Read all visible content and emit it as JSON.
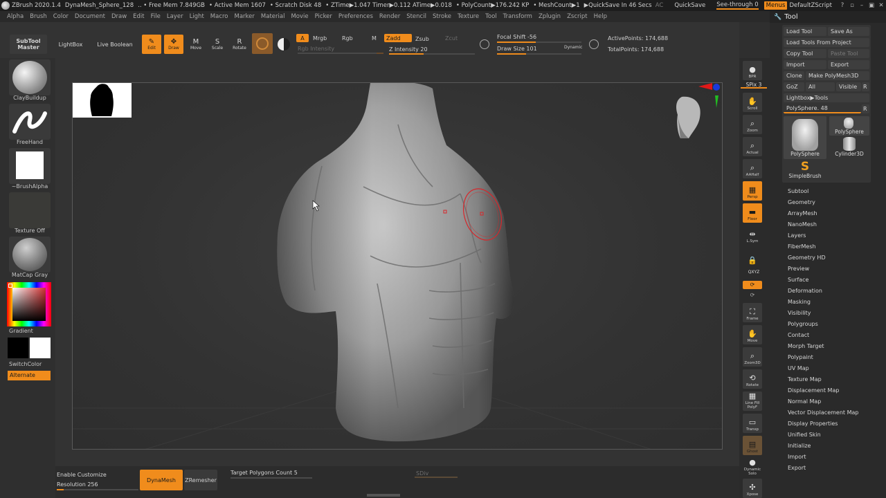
{
  "titlebar": {
    "app": "ZBrush 2020.1.4",
    "document": "DynaMesh_Sphere_128",
    "free_mem": ".. • Free Mem 7.849GB",
    "active_mem": "• Active Mem 1607",
    "scratch": "• Scratch Disk 48",
    "ztime": "• ZTime▶1.047 Timer▶0.112 ATime▶0.018",
    "polycount": "• PolyCount▶176.242 KP",
    "meshcount": "• MeshCount▶1",
    "quicksave": "▶QuickSave In 46 Secs",
    "ac": "AC",
    "quicksave_btn": "QuickSave",
    "see_through": "See-through  0",
    "menus": "Menus",
    "script": "DefaultZScript"
  },
  "menus": [
    "Alpha",
    "Brush",
    "Color",
    "Document",
    "Draw",
    "Edit",
    "File",
    "Layer",
    "Light",
    "Macro",
    "Marker",
    "Material",
    "Movie",
    "Picker",
    "Preferences",
    "Render",
    "Stencil",
    "Stroke",
    "Texture",
    "Tool",
    "Transform",
    "Zplugin",
    "Zscript",
    "Help"
  ],
  "toolbar": {
    "subtool_master": "SubTool Master",
    "lightbox": "LightBox",
    "live_boolean": "Live Boolean",
    "edit": "Edit",
    "draw": "Draw",
    "move": "Move",
    "scale": "Scale",
    "rotate": "Rotate",
    "a": "A",
    "mrgb": "Mrgb",
    "rgb": "Rgb",
    "m": "M",
    "zadd": "Zadd",
    "zsub": "Zsub",
    "zcut": "Zcut",
    "rgb_intensity": "Rgb Intensity",
    "z_intensity": "Z Intensity 20",
    "focal_shift": "Focal Shift -56",
    "draw_size": "Draw Size 101",
    "dynamic": "Dynamic",
    "active_points": "ActivePoints: 174,688",
    "total_points": "TotalPoints: 174,688"
  },
  "leftshelf": {
    "brush": "ClayBuildup",
    "stroke": "FreeHand",
    "alpha": "~BrushAlpha",
    "texture": "Texture Off",
    "material": "MatCap Gray",
    "gradient": "Gradient",
    "switchcolor": "SwitchColor",
    "alternate": "Alternate"
  },
  "rightshelf": [
    {
      "name": "bpr",
      "label": "BPR",
      "icon": "sphere-icon"
    },
    {
      "name": "spix",
      "label": "SPix 3",
      "icon": ""
    },
    {
      "name": "scroll",
      "label": "Scroll",
      "icon": "hand-icon"
    },
    {
      "name": "zoom",
      "label": "Zoom",
      "icon": "zoom-icon"
    },
    {
      "name": "actual",
      "label": "Actual",
      "icon": "zoom-icon"
    },
    {
      "name": "aahalf",
      "label": "AAHalf",
      "icon": "zoom-icon"
    },
    {
      "name": "persp",
      "label": "Persp",
      "icon": "grid-icon"
    },
    {
      "name": "floor",
      "label": "Floor",
      "icon": "floor-icon"
    },
    {
      "name": "lsym",
      "label": "L.Sym",
      "icon": "sym-icon"
    },
    {
      "name": "lock",
      "label": "",
      "icon": "lock-icon"
    },
    {
      "name": "xyz",
      "label": "QXYZ",
      "icon": ""
    },
    {
      "name": "frame",
      "label": "Frame",
      "icon": "frame-icon"
    },
    {
      "name": "move",
      "label": "Move",
      "icon": "hand-icon"
    },
    {
      "name": "zoom3d",
      "label": "Zoom3D",
      "icon": "zoom-icon"
    },
    {
      "name": "rotate",
      "label": "Rotate",
      "icon": "rotate-icon"
    },
    {
      "name": "linefill",
      "label": "Line Fill PolyF",
      "icon": "grid-icon"
    },
    {
      "name": "transp",
      "label": "Transp",
      "icon": "transp-icon"
    },
    {
      "name": "ghost",
      "label": "Ghost",
      "icon": "ghost-icon"
    },
    {
      "name": "solo",
      "label": "Dynamic Solo",
      "icon": "solo-icon"
    },
    {
      "name": "xpose",
      "label": "Xpose",
      "icon": "xpose-icon"
    }
  ],
  "toolpanel": {
    "title": "Tool",
    "load_tool": "Load Tool",
    "save_as": "Save As",
    "load_from_project": "Load Tools From Project",
    "copy_tool": "Copy Tool",
    "paste_tool": "Paste Tool",
    "import": "Import",
    "export": "Export",
    "clone": "Clone",
    "make_polymesh": "Make PolyMesh3D",
    "goz": "GoZ",
    "all": "All",
    "visible": "Visible",
    "r": "R",
    "lightbox_tools": "Lightbox▶Tools",
    "polysphere_slider": "PolySphere. 48",
    "r2": "R",
    "thumb1": "PolySphere",
    "thumb2": "PolySphere",
    "thumb3": "Cylinder3D",
    "thumb4": "SimpleBrush",
    "sections": [
      "Subtool",
      "Geometry",
      "ArrayMesh",
      "NanoMesh",
      "Layers",
      "FiberMesh",
      "Geometry HD",
      "Preview",
      "Surface",
      "Deformation",
      "Masking",
      "Visibility",
      "Polygroups",
      "Contact",
      "Morph Target",
      "Polypaint",
      "UV Map",
      "Texture Map",
      "Displacement Map",
      "Normal Map",
      "Vector Displacement Map",
      "Display Properties",
      "Unified Skin",
      "Initialize",
      "Import",
      "Export"
    ]
  },
  "bottombar": {
    "enable_customize": "Enable Customize",
    "resolution": "Resolution 256",
    "dynamesh": "DynaMesh",
    "zremesher": "ZRemesher",
    "target_polys": "Target Polygons Count 5",
    "sdiv": "SDiv"
  },
  "colors": {
    "accent": "#f08c1c",
    "bg": "#2f2f2f",
    "panel": "#2a2a2a"
  }
}
